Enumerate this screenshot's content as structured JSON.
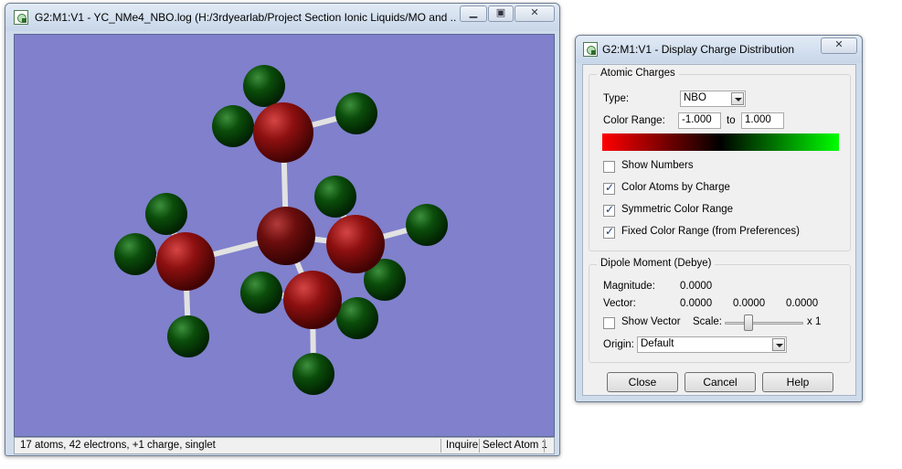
{
  "main_window": {
    "title": "G2:M1:V1 - YC_NMe4_NBO.log (H:/3rdyearlab/Project Section Ionic Liquids/MO and ...",
    "status": {
      "info": "17 atoms, 42 electrons, +1 charge, singlet",
      "mode": "Inquire",
      "action": "Select Atom 1"
    },
    "viewport_background": "#8080cc",
    "molecule": {
      "name": "tetramethylammonium",
      "atom_colors": {
        "center": "#6e1010",
        "carbon": "#8a0f0f",
        "hydrogen": "#0b4d0b",
        "bond": "#e2e2e2"
      }
    }
  },
  "dialog": {
    "title": "G2:M1:V1 - Display Charge Distribution",
    "atomic_charges": {
      "group_label": "Atomic Charges",
      "type_label": "Type:",
      "type_value": "NBO",
      "color_range_label": "Color Range:",
      "range_min": "-1.000",
      "range_to": "to",
      "range_max": "1.000",
      "gradient_colors": [
        "#ff0000",
        "#000000",
        "#00ff00"
      ],
      "options": [
        {
          "label": "Show Numbers",
          "checked": false
        },
        {
          "label": "Color Atoms by Charge",
          "checked": true
        },
        {
          "label": "Symmetric Color Range",
          "checked": true
        },
        {
          "label": "Fixed Color Range (from Preferences)",
          "checked": true
        }
      ]
    },
    "dipole": {
      "group_label": "Dipole Moment (Debye)",
      "magnitude_label": "Magnitude:",
      "magnitude": "0.0000",
      "vector_label": "Vector:",
      "vector": [
        "0.0000",
        "0.0000",
        "0.0000"
      ],
      "show_vector_label": "Show Vector",
      "show_vector_checked": false,
      "scale_label": "Scale:",
      "scale_value": "x 1",
      "scale_fraction": 0.28,
      "origin_label": "Origin:",
      "origin_value": "Default"
    },
    "buttons": {
      "close": "Close",
      "cancel": "Cancel",
      "help": "Help"
    }
  }
}
